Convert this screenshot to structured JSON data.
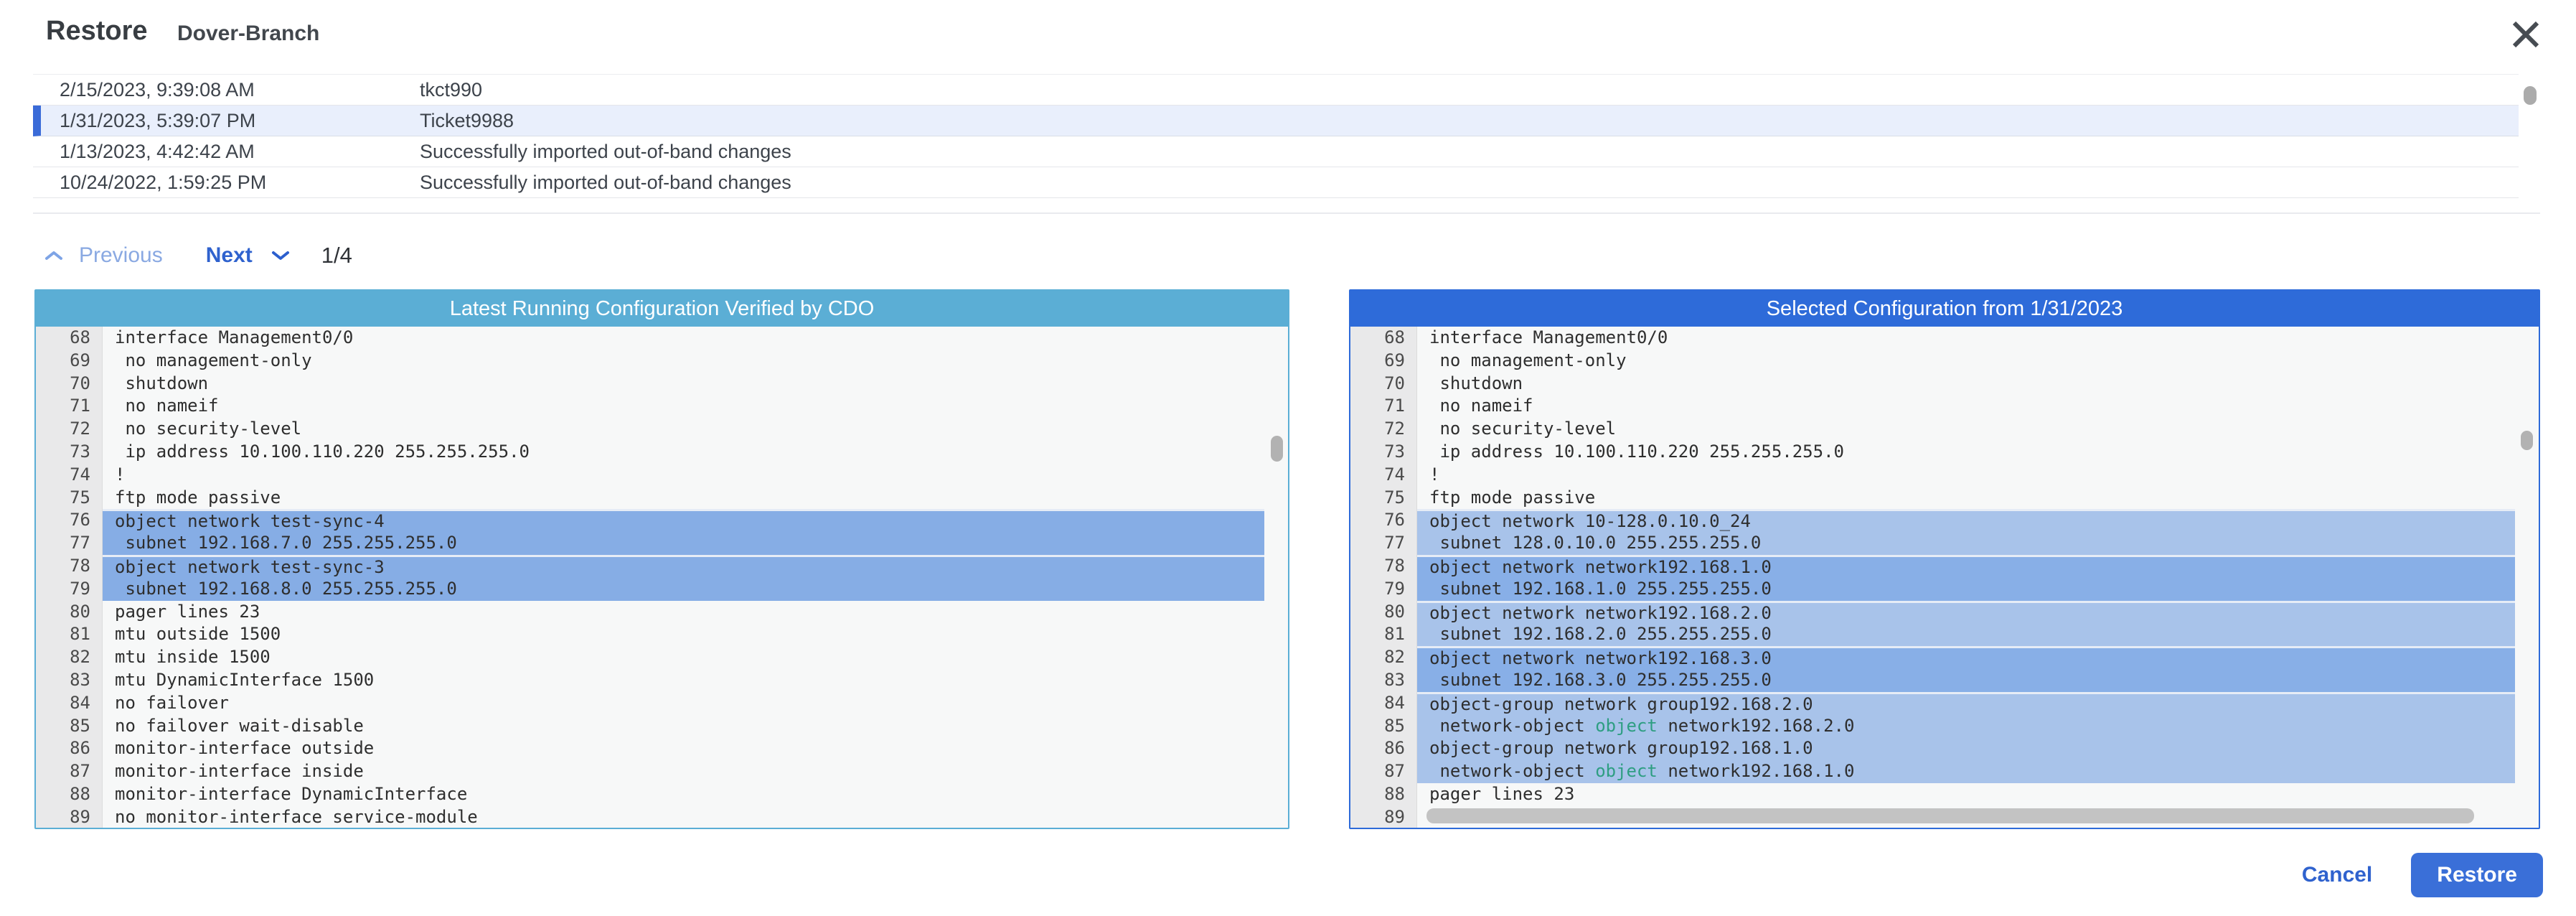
{
  "header": {
    "title": "Restore",
    "device_name": "Dover-Branch",
    "close_icon": "x-icon"
  },
  "table": {
    "rows": [
      {
        "date": "2/15/2023, 9:39:08 AM",
        "description": "tkct990",
        "selected": false
      },
      {
        "date": "1/31/2023, 5:39:07 PM",
        "description": "Ticket9988",
        "selected": true
      },
      {
        "date": "1/13/2023, 4:42:42 AM",
        "description": "Successfully imported out-of-band changes",
        "selected": false
      },
      {
        "date": "10/24/2022, 1:59:25 PM",
        "description": "Successfully imported out-of-band changes",
        "selected": false
      }
    ]
  },
  "pagination": {
    "previous_label": "Previous",
    "next_label": "Next",
    "page_indicator": "1/4"
  },
  "panels": {
    "left": {
      "title": "Latest Running Configuration Verified by CDO",
      "lines": [
        {
          "n": 68,
          "text": "interface Management0/0"
        },
        {
          "n": 69,
          "text": " no management-only"
        },
        {
          "n": 70,
          "text": " shutdown"
        },
        {
          "n": 71,
          "text": " no nameif"
        },
        {
          "n": 72,
          "text": " no security-level"
        },
        {
          "n": 73,
          "text": " ip address 10.100.110.220 255.255.255.0"
        },
        {
          "n": 74,
          "text": "!"
        },
        {
          "n": 75,
          "text": "ftp mode passive"
        },
        {
          "n": 76,
          "text": "object network test-sync-4",
          "hl": "left",
          "bs": true
        },
        {
          "n": 77,
          "text": " subnet 192.168.7.0 255.255.255.0",
          "hl": "left"
        },
        {
          "n": 78,
          "text": "object network test-sync-3",
          "hl": "left",
          "bs": true
        },
        {
          "n": 79,
          "text": " subnet 192.168.8.0 255.255.255.0",
          "hl": "left"
        },
        {
          "n": 80,
          "text": "pager lines 23"
        },
        {
          "n": 81,
          "text": "mtu outside 1500"
        },
        {
          "n": 82,
          "text": "mtu inside 1500"
        },
        {
          "n": 83,
          "text": "mtu DynamicInterface 1500"
        },
        {
          "n": 84,
          "text": "no failover"
        },
        {
          "n": 85,
          "text": "no failover wait-disable"
        },
        {
          "n": 86,
          "text": "monitor-interface outside"
        },
        {
          "n": 87,
          "text": "monitor-interface inside"
        },
        {
          "n": 88,
          "text": "monitor-interface DynamicInterface"
        },
        {
          "n": 89,
          "text": "no monitor-interface service-module"
        }
      ]
    },
    "right": {
      "title": "Selected Configuration from 1/31/2023",
      "lines": [
        {
          "n": 68,
          "text": "interface Management0/0"
        },
        {
          "n": 69,
          "text": " no management-only"
        },
        {
          "n": 70,
          "text": " shutdown"
        },
        {
          "n": 71,
          "text": " no nameif"
        },
        {
          "n": 72,
          "text": " no security-level"
        },
        {
          "n": 73,
          "text": " ip address 10.100.110.220 255.255.255.0"
        },
        {
          "n": 74,
          "text": "!"
        },
        {
          "n": 75,
          "text": "ftp mode passive"
        },
        {
          "n": 76,
          "text": "object network 10-128.0.10.0_24",
          "hl": "light",
          "bs": true
        },
        {
          "n": 77,
          "text": " subnet 128.0.10.0 255.255.255.0",
          "hl": "light"
        },
        {
          "n": 78,
          "text": "object network network192.168.1.0",
          "hl": "dark",
          "bs": true
        },
        {
          "n": 79,
          "text": " subnet 192.168.1.0 255.255.255.0",
          "hl": "dark"
        },
        {
          "n": 80,
          "text": "object network network192.168.2.0",
          "hl": "light",
          "bs": true
        },
        {
          "n": 81,
          "text": " subnet 192.168.2.0 255.255.255.0",
          "hl": "light"
        },
        {
          "n": 82,
          "text": "object network network192.168.3.0",
          "hl": "dark",
          "bs": true
        },
        {
          "n": 83,
          "text": " subnet 192.168.3.0 255.255.255.0",
          "hl": "dark"
        },
        {
          "n": 84,
          "text": "object-group network group192.168.2.0",
          "hl": "light",
          "bs": true
        },
        {
          "n": 85,
          "segs": [
            {
              "t": " network-object "
            },
            {
              "t": "object",
              "c": "kw"
            },
            {
              "t": " network192.168.2.0"
            }
          ],
          "hl": "light"
        },
        {
          "n": 86,
          "text": "object-group network group192.168.1.0",
          "hl": "light"
        },
        {
          "n": 87,
          "segs": [
            {
              "t": " network-object "
            },
            {
              "t": "object",
              "c": "kw"
            },
            {
              "t": " network192.168.1.0"
            }
          ],
          "hl": "light"
        },
        {
          "n": 88,
          "text": "pager lines 23"
        },
        {
          "n": 89,
          "text": ""
        }
      ]
    }
  },
  "footer": {
    "cancel_label": "Cancel",
    "restore_label": "Restore"
  },
  "colors": {
    "accent_left": "#5BAED5",
    "accent_right": "#2E6BD9",
    "hl_left": "#86ADE5",
    "hl_light": "#A8C3EA",
    "hl_dark": "#88AFE7",
    "selected_bg": "#E9EFFC",
    "selected_bar": "#3A6BD8",
    "button_blue": "#3A6FD8",
    "link_blue": "#2F62CE",
    "prev_blue": "#8AA9E2",
    "kw_green": "#2E9E82",
    "code_bg": "#F7F8F8",
    "gutter_bg": "#E9E9EA"
  }
}
